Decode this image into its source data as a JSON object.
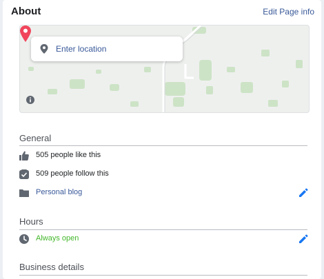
{
  "header": {
    "title": "About",
    "edit_label": "Edit Page info"
  },
  "map": {
    "location_placeholder": "Enter location",
    "icons": [
      "location-pin-icon",
      "map-marker-icon",
      "info-icon"
    ],
    "colors": {
      "marker": "#f0455b",
      "land": "#eef0ee",
      "parks": "#cde3c6",
      "roads": "#ffffff"
    }
  },
  "general": {
    "title": "General",
    "likes": "505 people like this",
    "follows": "509 people follow this",
    "category": "Personal blog",
    "icons": [
      "thumbs-up-icon",
      "follow-icon",
      "category-icon",
      "pencil-icon"
    ]
  },
  "hours": {
    "title": "Hours",
    "status": "Always open",
    "icons": [
      "clock-icon",
      "pencil-icon"
    ]
  },
  "business": {
    "title": "Business details"
  },
  "colors": {
    "link": "#385898",
    "edit_pencil": "#1877f2",
    "open_green": "#42b72a",
    "icon_gray": "#606770"
  }
}
